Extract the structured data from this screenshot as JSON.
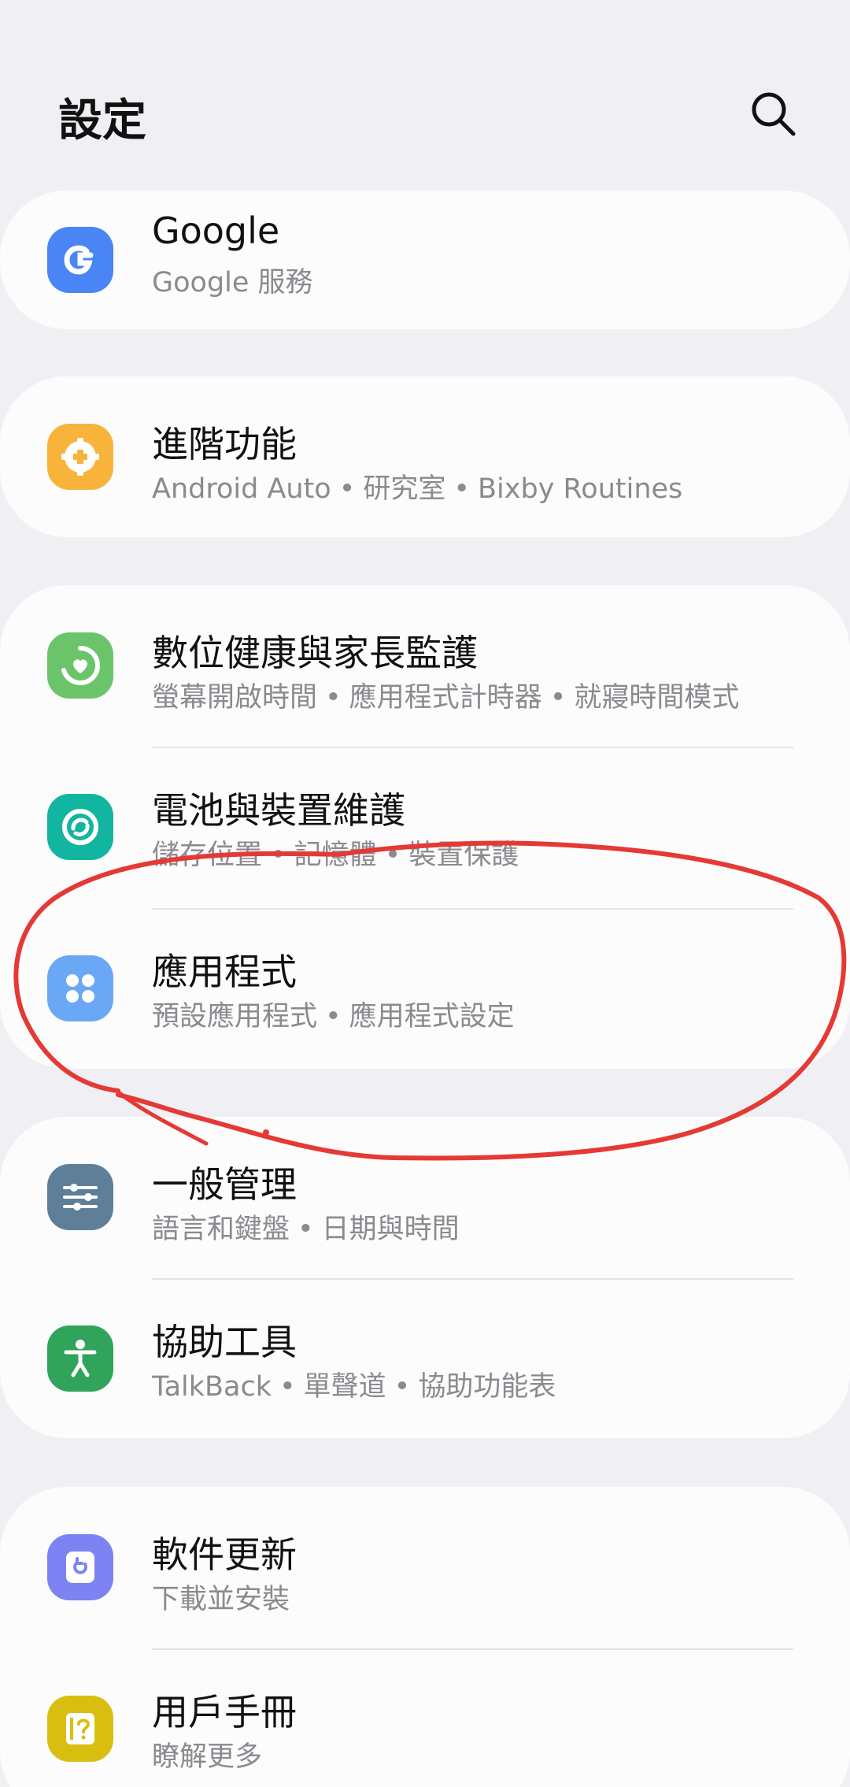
{
  "header": {
    "title": "設定",
    "search_icon": "search-icon"
  },
  "items": [
    {
      "id": "google",
      "label": "Google",
      "sub": [
        "Google 服務"
      ],
      "icon": "google-icon",
      "color": "#4a85f5"
    },
    {
      "id": "advanced",
      "label": "進階功能",
      "sub": [
        "Android Auto",
        "研究室",
        "Bixby Routines"
      ],
      "icon": "advanced-features-icon",
      "color": "#f8b43a"
    },
    {
      "id": "wellbeing",
      "label": "數位健康與家長監護",
      "sub": [
        "螢幕開啟時間",
        "應用程式計時器",
        "就寢時間模式"
      ],
      "icon": "digital-wellbeing-icon",
      "color": "#6cc46a"
    },
    {
      "id": "battery",
      "label": "電池與裝置維護",
      "sub": [
        "儲存位置",
        "記憶體",
        "裝置保護"
      ],
      "icon": "device-care-icon",
      "color": "#12b5a0"
    },
    {
      "id": "apps",
      "label": "應用程式",
      "sub": [
        "預設應用程式",
        "應用程式設定"
      ],
      "icon": "apps-icon",
      "color": "#6aa8f5"
    },
    {
      "id": "general",
      "label": "一般管理",
      "sub": [
        "語言和鍵盤",
        "日期與時間"
      ],
      "icon": "general-management-icon",
      "color": "#5f7f98"
    },
    {
      "id": "accessibility",
      "label": "協助工具",
      "sub": [
        "TalkBack",
        "單聲道",
        "協助功能表"
      ],
      "icon": "accessibility-icon",
      "color": "#2fa45a"
    },
    {
      "id": "update",
      "label": "軟件更新",
      "sub": [
        "下載並安裝"
      ],
      "icon": "software-update-icon",
      "color": "#7d83f2"
    },
    {
      "id": "manual",
      "label": "用戶手冊",
      "sub": [
        "瞭解更多"
      ],
      "icon": "user-manual-icon",
      "color": "#d9be12"
    }
  ],
  "annotation": {
    "color": "#e53935"
  }
}
